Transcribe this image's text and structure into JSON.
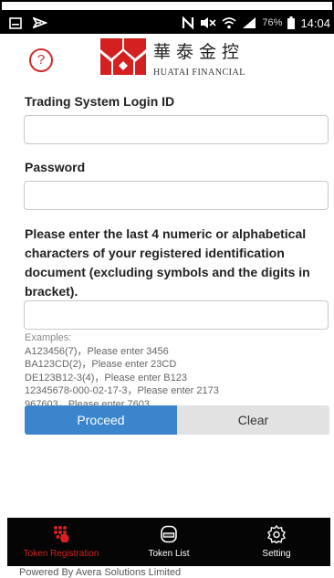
{
  "status_bar": {
    "battery_percent": "76%",
    "time": "14:04"
  },
  "header": {
    "help_symbol": "?",
    "logo_cn": "華泰金控",
    "logo_en": "HUATAI FINANCIAL",
    "brand_color": "#d42020"
  },
  "form": {
    "login_id_label": "Trading System Login ID",
    "login_id_value": "",
    "password_label": "Password",
    "password_value": "",
    "instruction": "Please enter the last 4 numeric or alphabetical characters of your registered identification document (excluding symbols and the digits in bracket).",
    "id_chars_value": "",
    "examples_title": "Examples:",
    "examples": [
      "A123456(7)，Please enter 3456",
      "BA123CD(2)，Please enter 23CD",
      "DE123B12-3(4)，Please enter B123",
      "12345678-000-02-17-3，Please enter 2173",
      "967603，Please enter 7603"
    ]
  },
  "actions": {
    "proceed_label": "Proceed",
    "clear_label": "Clear",
    "proceed_color": "#3a85cc"
  },
  "tabbar": {
    "tabs": [
      {
        "label": "Token Registration",
        "icon": "token-registration-icon",
        "active": true
      },
      {
        "label": "Token List",
        "icon": "token-list-icon",
        "active": false
      },
      {
        "label": "Setting",
        "icon": "gear-icon",
        "active": false
      }
    ]
  },
  "footer": {
    "text": "Powered By Avera Solutions Limited"
  }
}
